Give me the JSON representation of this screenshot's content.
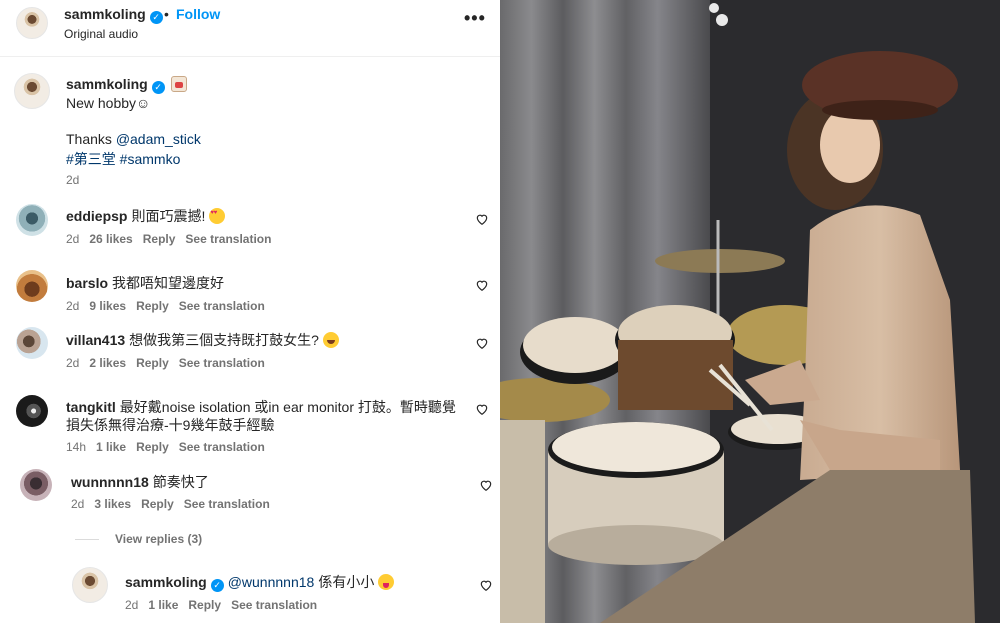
{
  "post": {
    "username": "sammkoling",
    "follow_label": "Follow",
    "audio_label": "Original audio",
    "more_icon": "more-options-icon"
  },
  "caption": {
    "username": "sammkoling",
    "line1": "New hobby☺",
    "line2_prefix": "Thanks ",
    "mention": "@adam_stick",
    "hashtags": "#第三堂 #sammko",
    "time": "2d"
  },
  "comments": [
    {
      "username": "eddiepsp",
      "text": "則面巧震撼!",
      "time": "2d",
      "likes": "26 likes",
      "reply": "Reply",
      "translate": "See translation"
    },
    {
      "username": "barslo",
      "text": "我都唔知望邊度好",
      "time": "2d",
      "likes": "9 likes",
      "reply": "Reply",
      "translate": "See translation"
    },
    {
      "username": "villan413",
      "text": "想做我第三個支持既打鼓女生?",
      "time": "2d",
      "likes": "2 likes",
      "reply": "Reply",
      "translate": "See translation"
    },
    {
      "username": "tangkitl",
      "text": "最好戴noise isolation 或in ear monitor 打鼓。暫時聽覺",
      "text2": "損失係無得治療-十9幾年鼓手經驗",
      "time": "14h",
      "likes": "1 like",
      "reply": "Reply",
      "translate": "See translation"
    },
    {
      "username": "wunnnnn18",
      "text": "節奏快了",
      "time": "2d",
      "likes": "3 likes",
      "reply": "Reply",
      "translate": "See translation"
    }
  ],
  "view_replies": "View replies (3)",
  "reply": {
    "username": "sammkoling",
    "mention": "@wunnnnn18",
    "text": "係有小小",
    "time": "2d",
    "likes": "1 like",
    "reply": "Reply",
    "translate": "See translation"
  },
  "colors": {
    "accent": "#0095f6",
    "link": "#00376b",
    "meta": "#737373"
  }
}
